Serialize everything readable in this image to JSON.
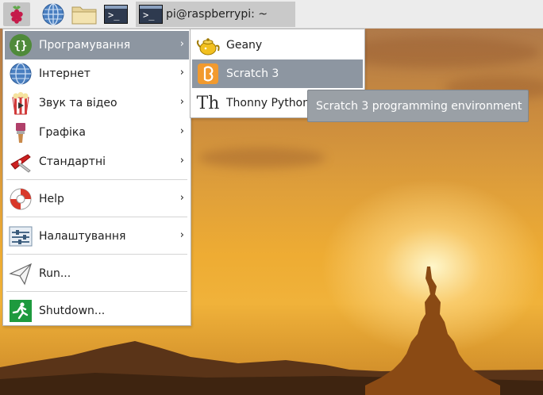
{
  "taskbar": {
    "launchers": [
      {
        "icon": "raspberry-logo-icon"
      },
      {
        "icon": "web-browser-globe-icon"
      },
      {
        "icon": "file-manager-folder-icon"
      },
      {
        "icon": "terminal-icon"
      }
    ],
    "task": {
      "icon": "terminal-icon",
      "glyph": ">_",
      "label": "pi@raspberrypi: ~"
    }
  },
  "main_menu": {
    "items": [
      {
        "label": "Програмування",
        "icon": "programming-braces-icon",
        "submenu": true,
        "highlighted": true
      },
      {
        "label": "Інтернет",
        "icon": "internet-globe-icon",
        "submenu": true
      },
      {
        "label": "Звук та відео",
        "icon": "sound-video-popcorn-icon",
        "submenu": true
      },
      {
        "label": "Графіка",
        "icon": "graphics-paintbrush-icon",
        "submenu": true
      },
      {
        "label": "Стандартні",
        "icon": "accessories-knife-icon",
        "submenu": true
      },
      {
        "label": "Help",
        "icon": "help-lifebuoy-icon",
        "submenu": true
      },
      {
        "label": "Налаштування",
        "icon": "preferences-sliders-icon",
        "submenu": true
      },
      {
        "label": "Run...",
        "icon": "run-paper-plane-icon",
        "submenu": false
      },
      {
        "label": "Shutdown...",
        "icon": "shutdown-exit-icon",
        "submenu": false
      }
    ],
    "arrow_glyph": "›"
  },
  "programming_submenu": {
    "items": [
      {
        "label": "Geany",
        "icon": "geany-teapot-icon"
      },
      {
        "label": "Scratch 3",
        "icon": "scratch-icon",
        "highlighted": true
      },
      {
        "label": "Thonny Python IDE",
        "icon": "thonny-icon",
        "glyph": "Th"
      }
    ]
  },
  "tooltip": {
    "text": "Scratch 3 programming environment"
  },
  "colors": {
    "highlight": "#8d96a1",
    "tooltip_bg": "#9aa0a6",
    "panel": "#ececec"
  }
}
